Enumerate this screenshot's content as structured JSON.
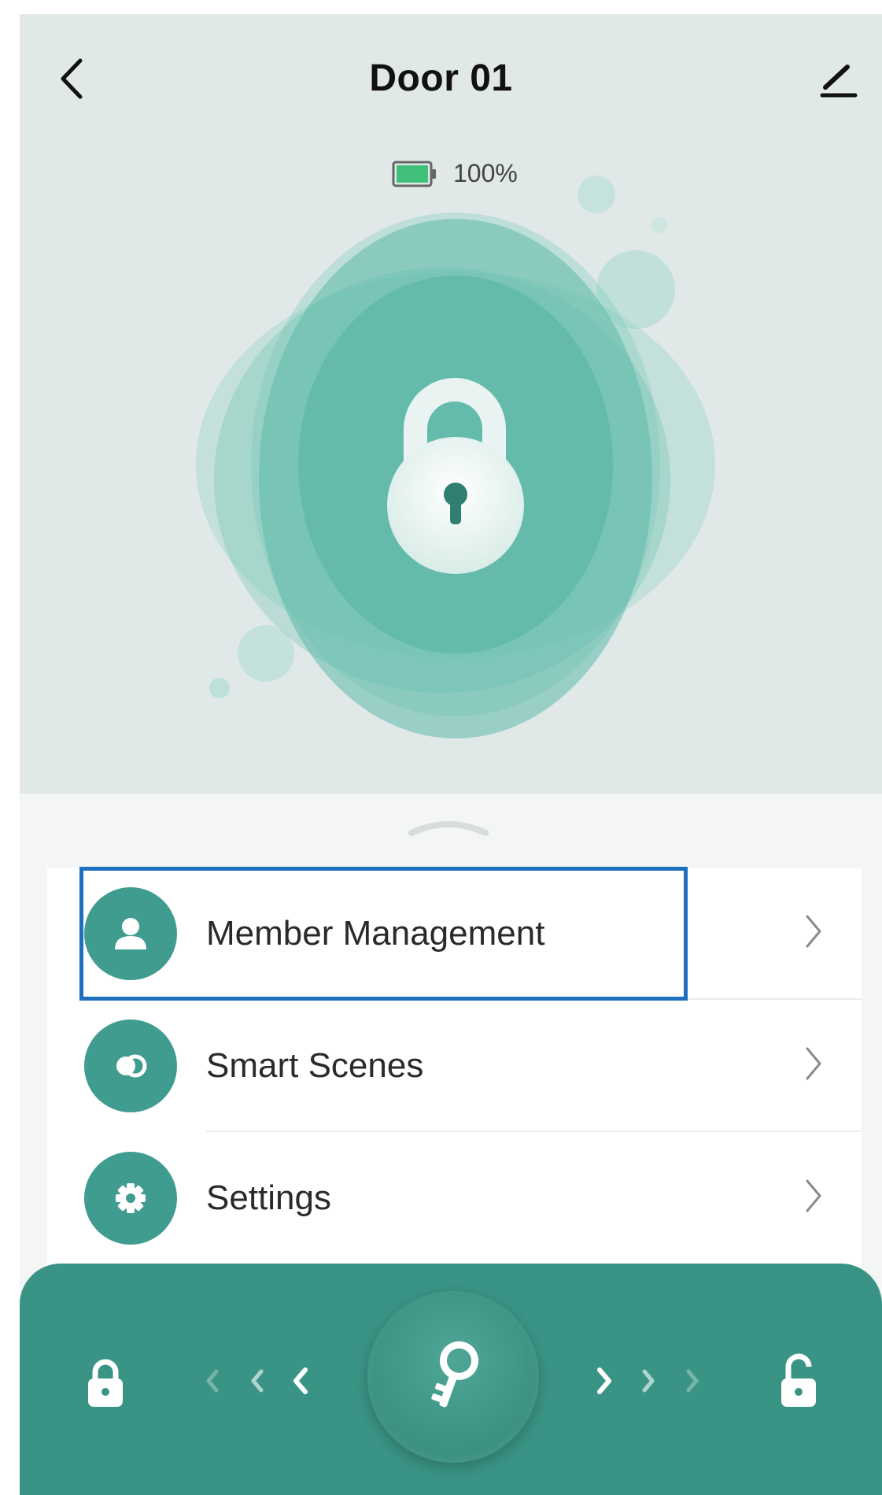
{
  "header": {
    "title": "Door 01",
    "back_icon": "chevron-left-icon",
    "edit_icon": "pencil-icon"
  },
  "status": {
    "battery_percent": "100%",
    "battery_level": 1.0,
    "lock_state_icon": "padlock-locked-icon"
  },
  "menu": {
    "items": [
      {
        "label": "Member Management",
        "icon": "person-icon"
      },
      {
        "label": "Smart Scenes",
        "icon": "scenes-icon"
      },
      {
        "label": "Settings",
        "icon": "gear-icon"
      }
    ],
    "highlighted_index": 0
  },
  "controls": {
    "lock_icon": "lock-icon",
    "unlock_icon": "unlock-icon",
    "key_icon": "key-icon",
    "swipe_left_icon": "chevrons-left-icon",
    "swipe_right_icon": "chevrons-right-icon"
  },
  "colors": {
    "accent": "#3f9c8f",
    "hero_bg": "#e0e8e8",
    "control_bar": "#3a9485",
    "highlight_border": "#1e6fbd",
    "battery_green": "#3fbf7a"
  }
}
